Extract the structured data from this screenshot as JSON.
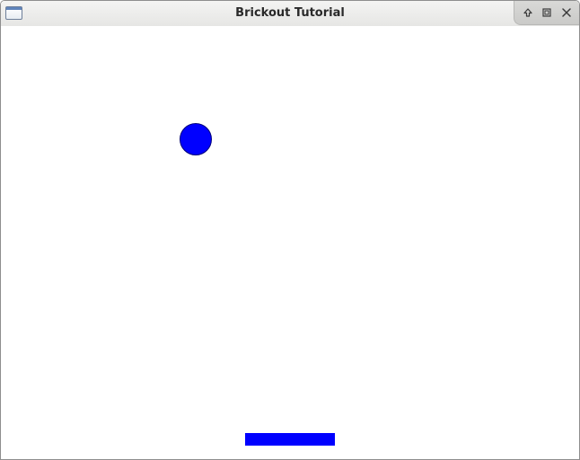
{
  "window": {
    "title": "Brickout Tutorial",
    "icon": "window-icon"
  },
  "controls": {
    "shade_icon": "arrow-up-icon",
    "maximize_icon": "maximize-icon",
    "close_icon": "close-icon"
  },
  "game": {
    "background_color": "#ffffff",
    "ball_color": "#0000ff",
    "paddle_color": "#0000ff"
  }
}
